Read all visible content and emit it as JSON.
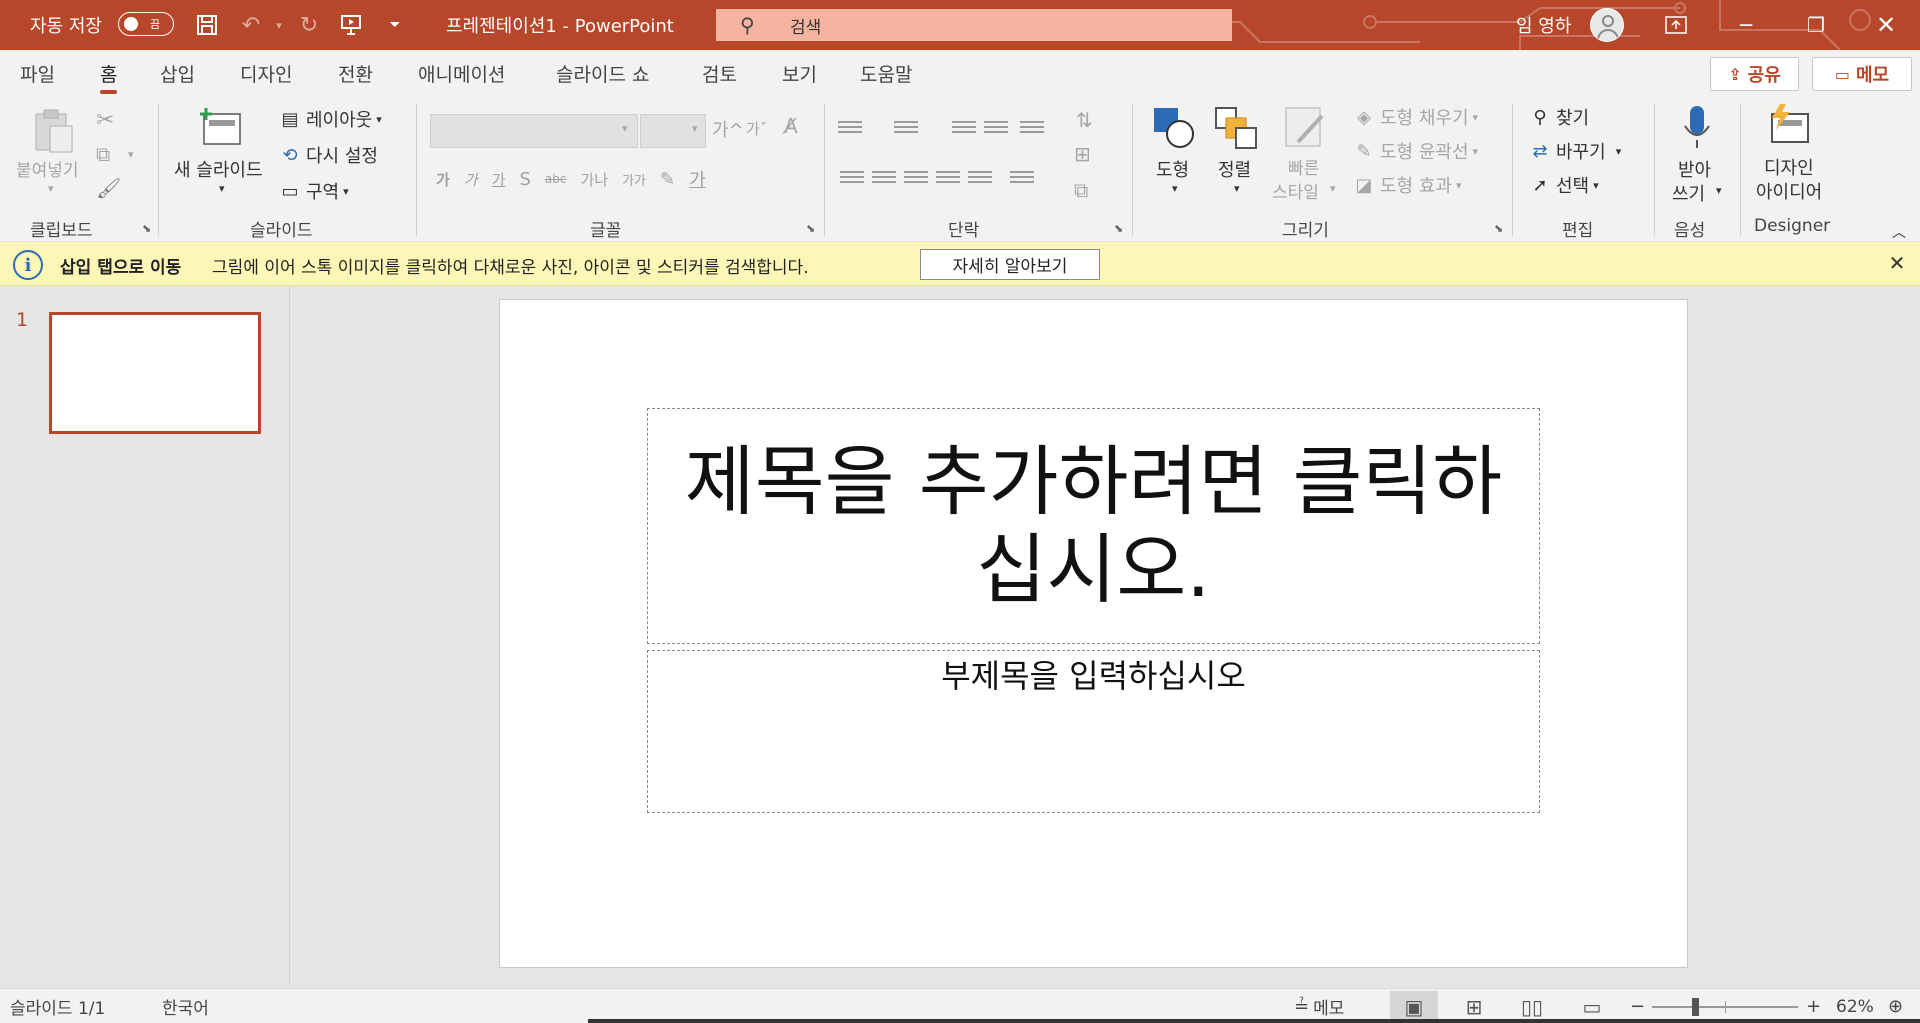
{
  "titlebar": {
    "autosave_label": "자동 저장",
    "autosave_state": "끔",
    "doc_title": "프레젠테이션1  -  PowerPoint",
    "search_placeholder": "검색",
    "user_name": "임 영하"
  },
  "tabs": [
    "파일",
    "홈",
    "삽입",
    "디자인",
    "전환",
    "애니메이션",
    "슬라이드 쇼",
    "검토",
    "보기",
    "도움말"
  ],
  "tab_active": "홈",
  "actions": {
    "share": "공유",
    "memo": "메모"
  },
  "ribbon": {
    "clipboard": {
      "label": "클립보드",
      "paste": "붙여넣기"
    },
    "slides": {
      "label": "슬라이드",
      "new_slide": "새 슬라이드",
      "layout": "레이아웃",
      "reset": "다시 설정",
      "section": "구역"
    },
    "font": {
      "label": "글꼴",
      "grow": "가",
      "shrink": "가",
      "format_buttons": [
        "가",
        "가",
        "가",
        "S",
        "abc",
        "가나",
        "가가"
      ]
    },
    "paragraph": {
      "label": "단락"
    },
    "drawing": {
      "label": "그리기",
      "shape": "도형",
      "arrange": "정렬",
      "quick_style_1": "빠른",
      "quick_style_2": "스타일",
      "shape_fill": "도형 채우기",
      "shape_outline": "도형 윤곽선",
      "shape_effect": "도형 효과"
    },
    "editing": {
      "label": "편집",
      "find": "찾기",
      "replace": "바꾸기",
      "select": "선택"
    },
    "voice": {
      "label": "음성",
      "dictate_1": "받아",
      "dictate_2": "쓰기"
    },
    "designer": {
      "label": "Designer",
      "ideas_1": "디자인",
      "ideas_2": "아이디어"
    }
  },
  "infobar": {
    "title": "삽입 탭으로 이동",
    "message": "그림에 이어 스톡 이미지를 클릭하여 다채로운 사진, 아이콘 및 스티커를 검색합니다.",
    "learn_more": "자세히 알아보기"
  },
  "thumbnails": [
    {
      "number": "1"
    }
  ],
  "slide": {
    "title_placeholder": "제목을 추가하려면 클릭하십시오.",
    "subtitle_placeholder": "부제목을 입력하십시오"
  },
  "statusbar": {
    "slide_count": "슬라이드 1/1",
    "language": "한국어",
    "notes": "메모",
    "zoom": "62%"
  },
  "colors": {
    "accent": "#b7472a",
    "infobar": "#fcf7b6"
  }
}
